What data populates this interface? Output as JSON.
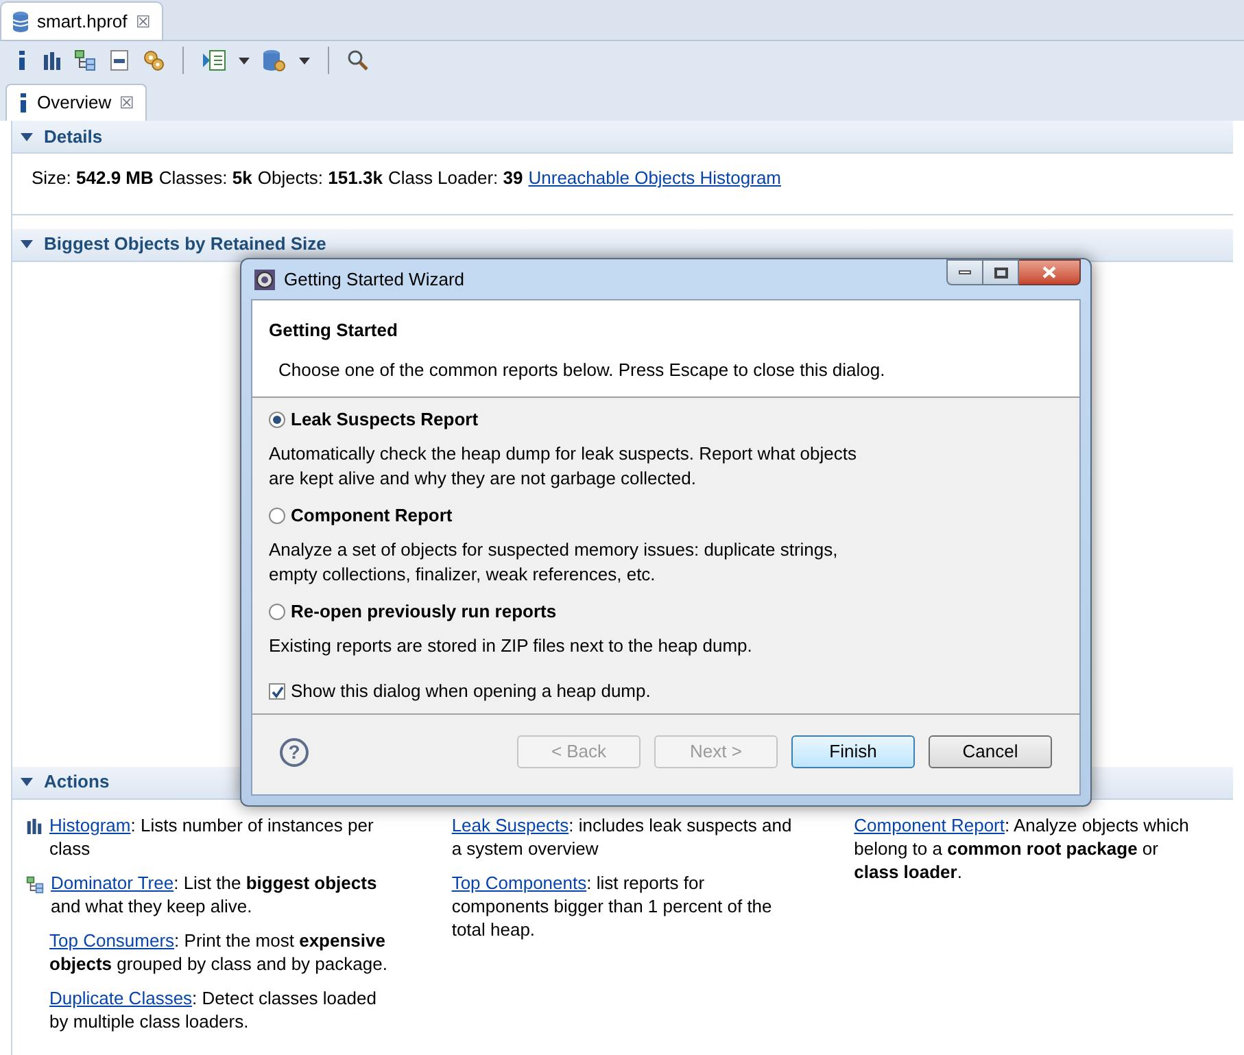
{
  "editor_tab": {
    "title": "smart.hprof",
    "close": "☒"
  },
  "toolbar": {
    "tools": [
      {
        "kind": "info"
      },
      {
        "kind": "histogram"
      },
      {
        "kind": "tree"
      },
      {
        "kind": "oql"
      },
      {
        "kind": "gears"
      },
      {
        "kind": "separator"
      },
      {
        "kind": "report",
        "dropdown": true
      },
      {
        "kind": "database",
        "dropdown": true
      },
      {
        "kind": "separator"
      },
      {
        "kind": "search"
      }
    ]
  },
  "view_tab": {
    "title": "Overview",
    "close": "☒"
  },
  "details": {
    "title": "Details",
    "parts": [
      {
        "label": "Size:",
        "value": "542.9 MB"
      },
      {
        "label": "Classes:",
        "value": "5k"
      },
      {
        "label": "Objects:",
        "value": "151.3k"
      },
      {
        "label": "Class Loader:",
        "value": "39"
      }
    ],
    "link": "Unreachable Objects Histogram",
    "expanded": true
  },
  "biggest": {
    "title": "Biggest Objects by Retained Size",
    "expanded": true
  },
  "actions": {
    "title": "Actions",
    "expanded": true,
    "columns": [
      [
        {
          "kind": "histogram",
          "link": "Histogram",
          "text": ": Lists number of instances per class"
        },
        {
          "kind": "tree",
          "link": "Dominator Tree",
          "text": ": List the **biggest objects** and what they keep alive."
        },
        {
          "kind": "plain",
          "link": "Top Consumers",
          "text": ": Print the most **expensive objects** grouped by class and by package."
        },
        {
          "kind": "plain",
          "link": "Duplicate Classes",
          "text": ": Detect classes loaded by multiple class loaders."
        }
      ],
      [
        {
          "kind": "plain",
          "link": "Leak Suspects",
          "text": ": includes leak suspects and a system overview"
        },
        {
          "kind": "plain",
          "link": "Top Components",
          "text": ": list reports for components bigger than 1 percent of the total heap."
        }
      ],
      [
        {
          "kind": "plain",
          "link": "Component Report",
          "text": ": Analyze objects which belong to a **common root package** or **class loader**."
        }
      ]
    ]
  },
  "dialog": {
    "title": "Getting Started Wizard",
    "heading": "Getting Started",
    "message": "Choose one of the common reports below. Press Escape to close this dialog.",
    "options": [
      {
        "label": "Leak Suspects Report",
        "selected": true,
        "description": "Automatically check the heap dump for leak suspects. Report what objects are kept alive and why they are not garbage collected."
      },
      {
        "label": "Component Report",
        "selected": false,
        "description": "Analyze a set of objects for suspected memory issues: duplicate strings, empty collections, finalizer, weak references, etc."
      },
      {
        "label": "Re-open previously run reports",
        "selected": false,
        "description": "Existing reports are stored in ZIP files next to the heap dump."
      }
    ],
    "show_on_open": {
      "label": "Show this dialog when opening a heap dump.",
      "checked": true
    },
    "help": "?",
    "buttons": [
      {
        "label": "< Back",
        "disabled": true,
        "default": false
      },
      {
        "label": "Next >",
        "disabled": true,
        "default": false
      },
      {
        "label": "Finish",
        "disabled": false,
        "default": true
      },
      {
        "label": "Cancel",
        "disabled": false,
        "default": false
      }
    ]
  }
}
